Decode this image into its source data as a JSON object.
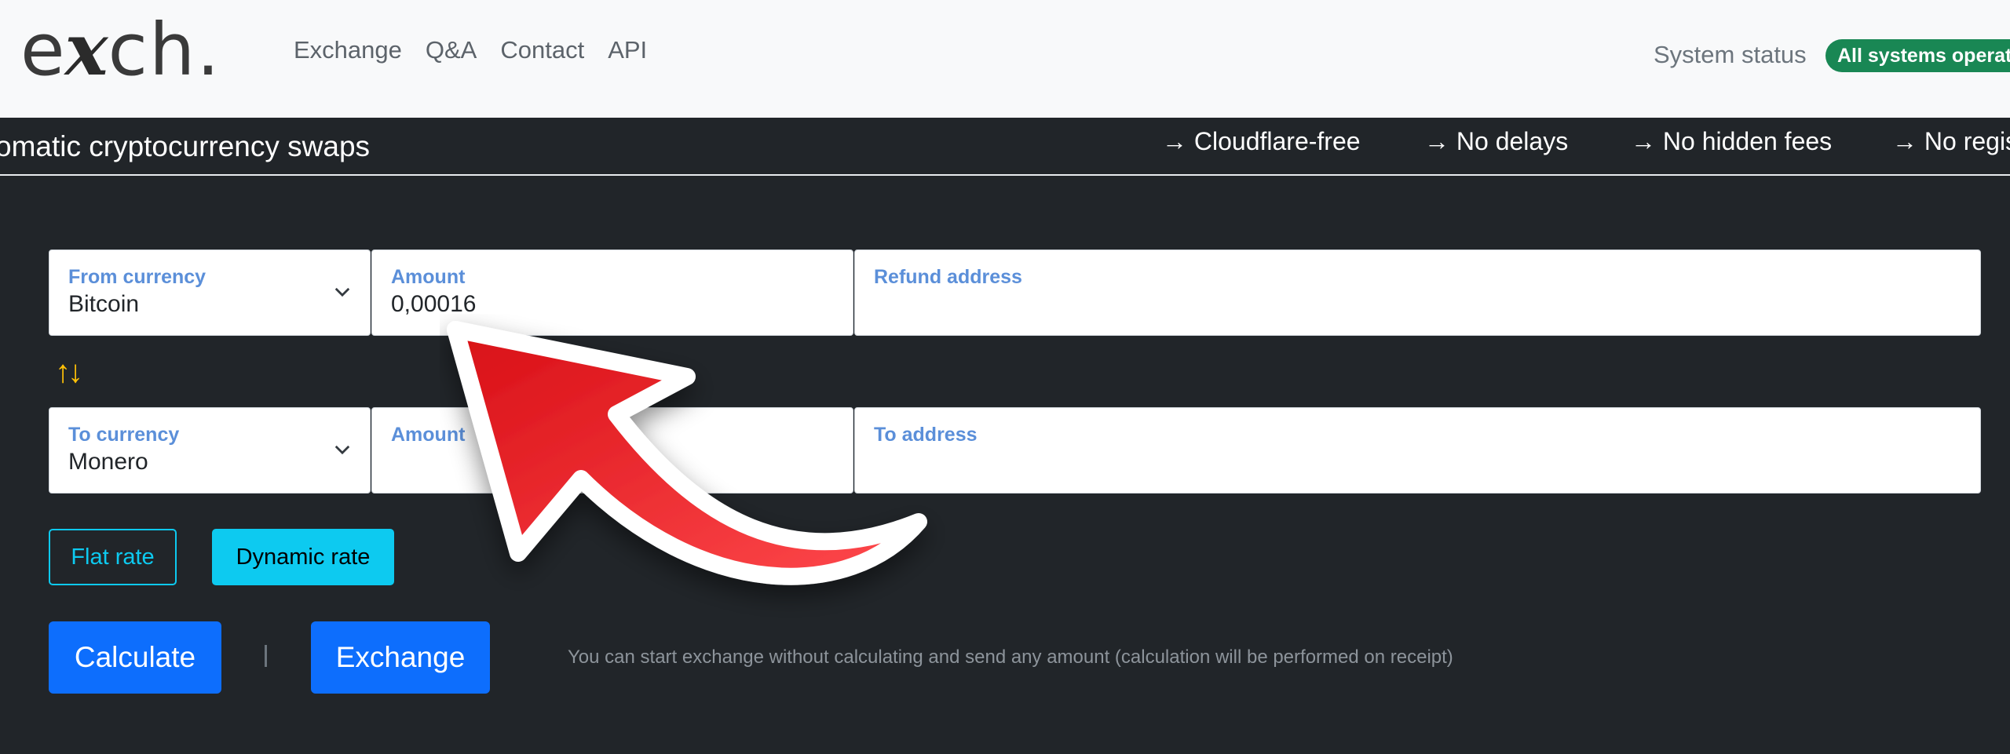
{
  "header": {
    "logo": {
      "pre": "e",
      "x": "x",
      "post": "ch."
    },
    "nav": [
      "Exchange",
      "Q&A",
      "Contact",
      "API"
    ],
    "status_label": "System status",
    "status_badge": "All systems operati"
  },
  "marquee": {
    "tagline": "omatic cryptocurrency swaps",
    "features": [
      "→ Cloudflare-free",
      "→ No delays",
      "→ No hidden fees",
      "→ No regis"
    ]
  },
  "form": {
    "from_currency": {
      "label": "From currency",
      "value": "Bitcoin"
    },
    "from_amount": {
      "label": "Amount",
      "value": "0,00016"
    },
    "refund_address": {
      "label": "Refund address",
      "value": ""
    },
    "swap_icon": "↑↓",
    "to_currency": {
      "label": "To currency",
      "value": "Monero"
    },
    "to_amount": {
      "label": "Amount",
      "value": ""
    },
    "to_address": {
      "label": "To address",
      "value": ""
    }
  },
  "rates": {
    "flat": "Flat rate",
    "dynamic": "Dynamic rate"
  },
  "actions": {
    "calculate": "Calculate",
    "exchange": "Exchange",
    "hint": "You can start exchange without calculating and send any amount (calculation will be performed on receipt)"
  },
  "colors": {
    "accent": "#0d6efd",
    "info": "#0dcaf0",
    "success": "#198754",
    "swap": "#ffc107",
    "annotation": "#e8202a"
  }
}
